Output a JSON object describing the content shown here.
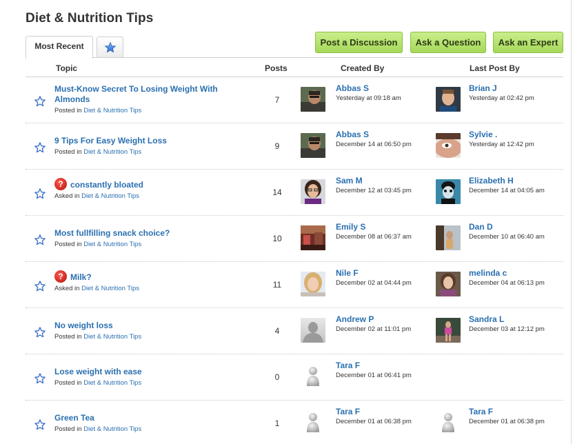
{
  "page": {
    "title": "Diet & Nutrition Tips"
  },
  "tabs": {
    "most_recent": "Most Recent",
    "favorites_icon": "star-icon"
  },
  "buttons": {
    "post_discussion": "Post a Discussion",
    "ask_question": "Ask a Question",
    "ask_expert": "Ask an Expert"
  },
  "columns": {
    "topic": "Topic",
    "posts": "Posts",
    "created_by": "Created By",
    "last_post_by": "Last Post By"
  },
  "colors": {
    "link": "#2a6fb0",
    "button_green": "#a5d85a",
    "question_red": "#d0211a"
  },
  "rows": [
    {
      "title": "Must-Know Secret To Losing Weight With Almonds",
      "is_question": false,
      "meta_prefix": "Posted in",
      "category": "Diet & Nutrition Tips",
      "posts": "7",
      "created_by": {
        "name": "Abbas S",
        "time": "Yesterday at 09:18 am",
        "avatar": "photo-man-dark"
      },
      "last_post_by": {
        "name": "Brian J",
        "time": "Yesterday at 02:42 pm",
        "avatar": "photo-man-smile"
      }
    },
    {
      "title": "9 Tips For Easy Weight Loss",
      "is_question": false,
      "meta_prefix": "Posted in",
      "category": "Diet & Nutrition Tips",
      "posts": "9",
      "created_by": {
        "name": "Abbas S",
        "time": "December 14 at 06:50 pm",
        "avatar": "photo-man-dark"
      },
      "last_post_by": {
        "name": "Sylvie .",
        "time": "Yesterday at 12:42 pm",
        "avatar": "photo-woman-eye"
      }
    },
    {
      "title": "constantly bloated",
      "is_question": true,
      "question_mark": "?",
      "meta_prefix": "Asked in",
      "category": "Diet & Nutrition Tips",
      "posts": "14",
      "created_by": {
        "name": "Sam M",
        "time": "December 12 at 03:45 pm",
        "avatar": "photo-woman-glasses"
      },
      "last_post_by": {
        "name": "Elizabeth H",
        "time": "December 14 at 04:05 am",
        "avatar": "photo-costume"
      }
    },
    {
      "title": "Most fullfilling snack choice?",
      "is_question": false,
      "meta_prefix": "Posted in",
      "category": "Diet & Nutrition Tips",
      "posts": "10",
      "created_by": {
        "name": "Emily S",
        "time": "December 08 at 06:37 am",
        "avatar": "photo-room"
      },
      "last_post_by": {
        "name": "Dan D",
        "time": "December 10 at 06:40 am",
        "avatar": "photo-outdoor"
      }
    },
    {
      "title": "Milk?",
      "is_question": true,
      "question_mark": "?",
      "meta_prefix": "Asked in",
      "category": "Diet & Nutrition Tips",
      "posts": "11",
      "created_by": {
        "name": "Nile F",
        "time": "December 02 at 04:44 pm",
        "avatar": "photo-girl-blonde"
      },
      "last_post_by": {
        "name": "melinda c",
        "time": "December 04 at 06:13 pm",
        "avatar": "photo-girl-brown"
      }
    },
    {
      "title": "No weight loss",
      "is_question": false,
      "meta_prefix": "Posted in",
      "category": "Diet & Nutrition Tips",
      "posts": "4",
      "created_by": {
        "name": "Andrew P",
        "time": "December 02 at 11:01 pm",
        "avatar": "default-silhouette"
      },
      "last_post_by": {
        "name": "Sandra L",
        "time": "December 03 at 12:12 pm",
        "avatar": "photo-woman-pink"
      }
    },
    {
      "title": "Lose weight with ease",
      "is_question": false,
      "meta_prefix": "Posted in",
      "category": "Diet & Nutrition Tips",
      "posts": "0",
      "created_by": {
        "name": "Tara F",
        "time": "December 01 at 06:41 pm",
        "avatar": "default-person"
      },
      "last_post_by": null
    },
    {
      "title": "Green Tea",
      "is_question": false,
      "meta_prefix": "Posted in",
      "category": "Diet & Nutrition Tips",
      "posts": "1",
      "created_by": {
        "name": "Tara F",
        "time": "December 01 at 06:38 pm",
        "avatar": "default-person"
      },
      "last_post_by": {
        "name": "Tara F",
        "time": "December 01 at 06:38 pm",
        "avatar": "default-person"
      }
    }
  ]
}
